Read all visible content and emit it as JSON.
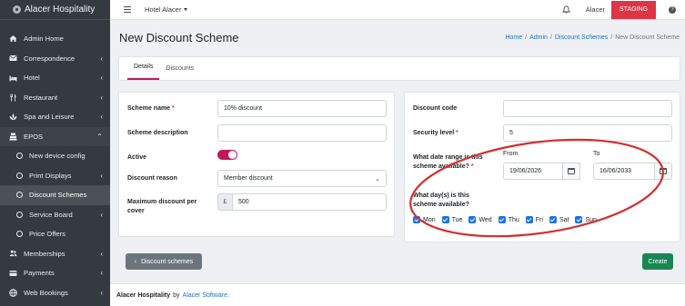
{
  "brand": {
    "name": "Alacer Hospitality"
  },
  "sidebar": {
    "items": [
      {
        "label": "Admin Home",
        "icon": "dashboard-icon"
      },
      {
        "label": "Correspondence",
        "icon": "envelope-icon"
      },
      {
        "label": "Hotel",
        "icon": "bed-icon"
      },
      {
        "label": "Restaurant",
        "icon": "utensils-icon"
      },
      {
        "label": "Spa and Leisure",
        "icon": "spa-icon"
      },
      {
        "label": "EPOS",
        "icon": "cash-register-icon"
      }
    ],
    "epos_sub": [
      {
        "label": "New device config"
      },
      {
        "label": "Print Displays"
      },
      {
        "label": "Discount Schemes"
      },
      {
        "label": "Service Board"
      },
      {
        "label": "Price Offers"
      }
    ],
    "bottom_items": [
      {
        "label": "Memberships",
        "icon": "users-icon"
      },
      {
        "label": "Payments",
        "icon": "credit-card-icon"
      },
      {
        "label": "Web Bookings",
        "icon": "globe-icon"
      }
    ]
  },
  "topbar": {
    "hotel": "Hotel Alacer",
    "user": "Alacer",
    "env_badge": "STAGING",
    "help": "?"
  },
  "page": {
    "title": "New Discount Scheme",
    "breadcrumb": [
      "Home",
      "Admin",
      "Discount Schemes",
      "New Discount Scheme"
    ],
    "breadcrumb_sep": "/"
  },
  "tabs": [
    "Details",
    "Discounts"
  ],
  "form": {
    "scheme_name_label": "Scheme name",
    "scheme_name_value": "10% discount",
    "scheme_description_label": "Scheme description",
    "scheme_description_value": "",
    "active_label": "Active",
    "active_value": true,
    "discount_reason_label": "Discount reason",
    "discount_reason_value": "Member discount",
    "max_discount_label_1": "Maximum discount per",
    "max_discount_label_2": "cover",
    "currency_prefix": "£",
    "max_discount_value": "500",
    "discount_code_label": "Discount code",
    "discount_code_value": "",
    "security_level_label": "Security level",
    "security_level_value": "5",
    "date_range_label_1": "What date range is this",
    "date_range_label_2": "scheme available?",
    "from_label": "From",
    "to_label": "To",
    "from_value": "19/06/2026",
    "to_value": "16/06/2033",
    "days_label_1": "What day(s) is this",
    "days_label_2": "scheme available?",
    "days": [
      "Mon",
      "Tue",
      "Wed",
      "Thu",
      "Fri",
      "Sat",
      "Sun"
    ],
    "required_mark": "*"
  },
  "buttons": {
    "back": "Discount schemes",
    "create": "Create"
  },
  "footer": {
    "company": "Alacer Hospitality",
    "by": "by",
    "vendor": "Alacer Software."
  },
  "colors": {
    "sidebar_bg": "#343a40",
    "accent": "#c2185b",
    "staging": "#dc3545",
    "create": "#198754",
    "link": "#1a73c8",
    "annotation": "#d32f2f"
  }
}
